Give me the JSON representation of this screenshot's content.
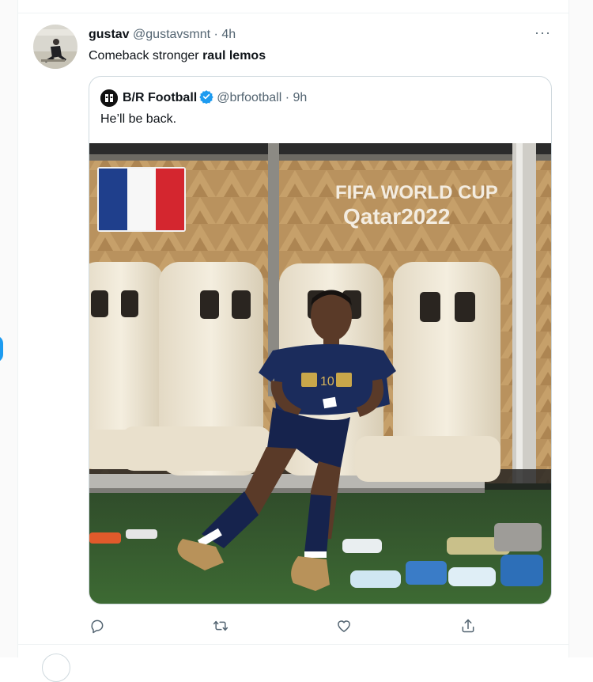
{
  "tweet": {
    "author_name": "gustav",
    "author_handle": "@gustavsmnt",
    "separator": "·",
    "time": "4h",
    "more_label": "···",
    "text_prefix": "Comeback stronger ",
    "text_mention": "raul lemos"
  },
  "quoted_tweet": {
    "author_name": "B/R Football",
    "author_handle": "@brfootball",
    "separator": "·",
    "time": "9h",
    "text": "He’ll be back.",
    "verified": true
  },
  "media_text": {
    "sign_line1": "FIFA WORLD CUP",
    "sign_line2": "Qatar2022",
    "jersey_number": "10"
  },
  "actions": [
    {
      "name": "reply-icon"
    },
    {
      "name": "retweet-icon"
    },
    {
      "name": "like-icon"
    },
    {
      "name": "share-icon"
    }
  ],
  "colors": {
    "accent": "#1d9bf0",
    "text": "#0f1419",
    "muted": "#536471",
    "border": "#cfd9de"
  }
}
